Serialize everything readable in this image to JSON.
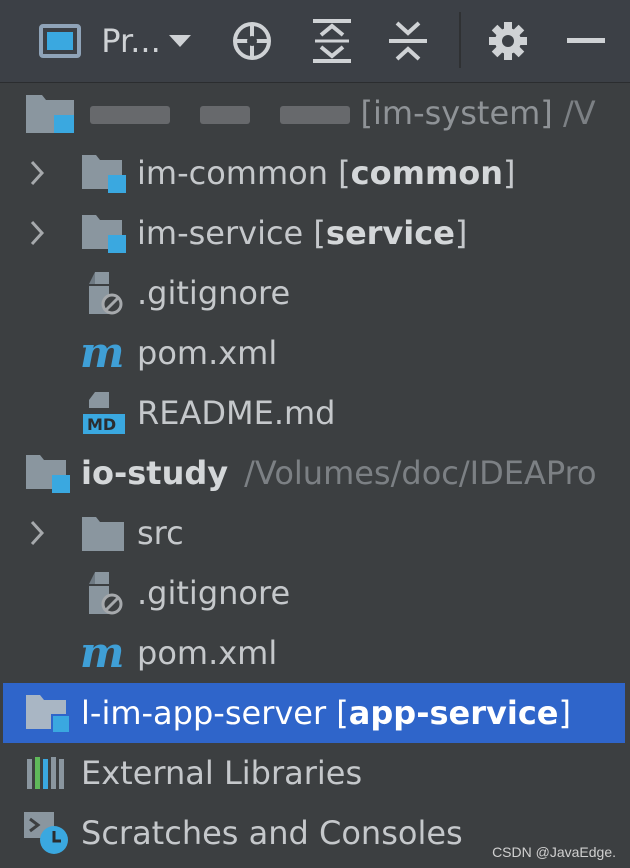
{
  "toolbar": {
    "view_label": "Pr...",
    "icons": [
      "project-window-icon",
      "dropdown-icon",
      "locate-icon",
      "expand-all-icon",
      "collapse-all-icon",
      "gear-icon",
      "minimize-icon"
    ]
  },
  "tree": {
    "root1": {
      "name_hidden": "[im-system]",
      "path_hint": "/V"
    },
    "im_common": {
      "name": "im-common ",
      "module": "common",
      "bracket_open": "[",
      "bracket_close": "]"
    },
    "im_service": {
      "name": "im-service ",
      "module": "service",
      "bracket_open": "[",
      "bracket_close": "]"
    },
    "gitignore1": ".gitignore",
    "pom1": "pom.xml",
    "readme": "README.md",
    "io_study": {
      "name": "io-study",
      "path": "/Volumes/doc/IDEAPro"
    },
    "src": "src",
    "gitignore2": ".gitignore",
    "pom2": "pom.xml",
    "app_server": {
      "name": "l-im-app-server ",
      "module": "app-service",
      "bracket_open": "[",
      "bracket_close": "]"
    },
    "external_libraries": "External Libraries",
    "scratches": "Scratches and Consoles"
  },
  "watermark": "CSDN @JavaEdge.",
  "colors": {
    "background": "#3c3f41",
    "toolbar": "#3c4046",
    "selection": "#2f65ca",
    "module_badge": "#3aa8e0",
    "maven_blue": "#3f9fd6"
  }
}
